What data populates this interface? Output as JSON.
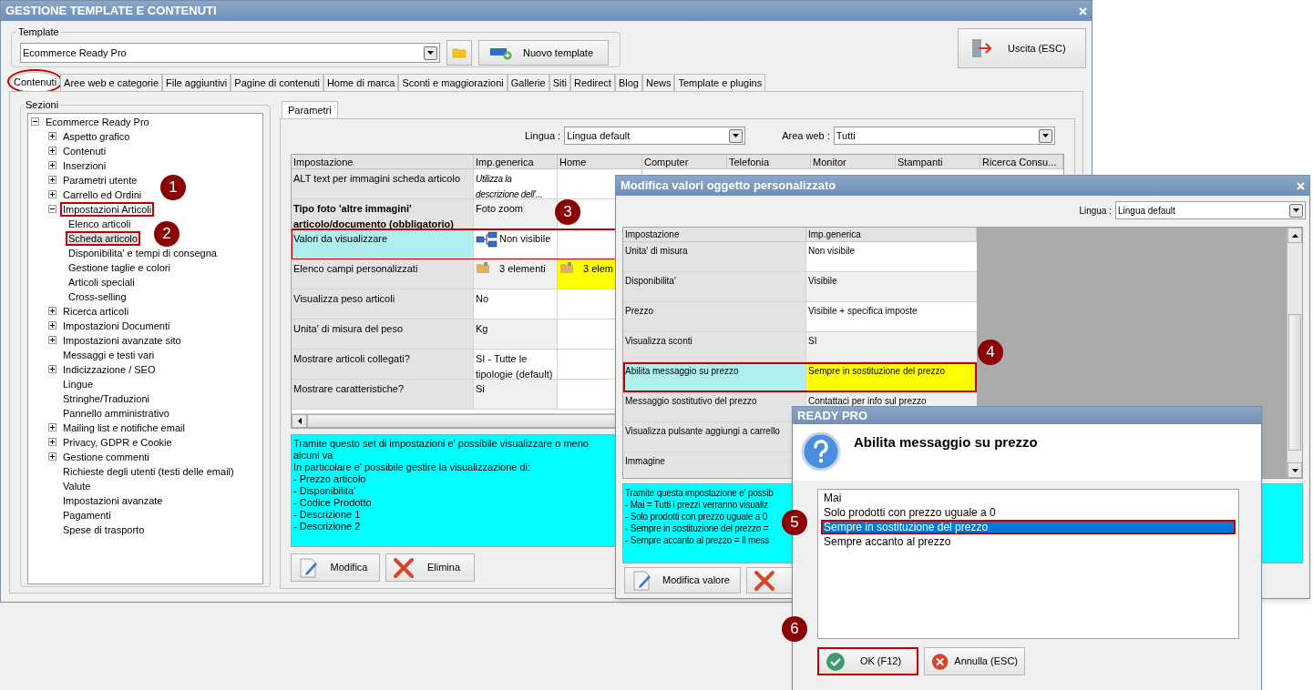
{
  "main_window": {
    "title": "GESTIONE TEMPLATE E CONTENUTI",
    "template": {
      "label": "Template",
      "value": "Ecommerce Ready Pro",
      "new_button": "Nuovo template"
    },
    "exit_button": "Uscita (ESC)",
    "tabs": [
      {
        "label": "Contenuti",
        "selected": true,
        "annotated": true
      },
      {
        "label": "Aree web e categorie",
        "selected": false,
        "annotated": false
      },
      {
        "label": "File aggiuntivi",
        "selected": false,
        "annotated": false
      },
      {
        "label": "Pagine di contenuti",
        "selected": false,
        "annotated": false
      },
      {
        "label": "Home di marca",
        "selected": false,
        "annotated": false
      },
      {
        "label": "Sconti e maggiorazioni",
        "selected": false,
        "annotated": false
      },
      {
        "label": "Gallerie",
        "selected": false,
        "annotated": false
      },
      {
        "label": "Siti",
        "selected": false,
        "annotated": false
      },
      {
        "label": "Redirect",
        "selected": false,
        "annotated": false
      },
      {
        "label": "Blog",
        "selected": false,
        "annotated": false
      },
      {
        "label": "News",
        "selected": false,
        "annotated": false
      },
      {
        "label": "Template e plugins",
        "selected": false,
        "annotated": false
      }
    ],
    "sections": {
      "label": "Sezioni",
      "tree": {
        "label": "Ecommerce Ready Pro",
        "kind": "node",
        "expanded": true,
        "selected": false,
        "annotated": false,
        "children": [
          {
            "label": "Aspetto grafico",
            "kind": "node",
            "expanded": false,
            "selected": false,
            "annotated": false
          },
          {
            "label": "Contenuti",
            "kind": "node",
            "expanded": false,
            "selected": false,
            "annotated": false
          },
          {
            "label": "Inserzioni",
            "kind": "node",
            "expanded": false,
            "selected": false,
            "annotated": false
          },
          {
            "label": "Parametri utente",
            "kind": "node",
            "expanded": false,
            "selected": false,
            "annotated": false
          },
          {
            "label": "Carrello ed Ordini",
            "kind": "node",
            "expanded": false,
            "selected": false,
            "annotated": false
          },
          {
            "label": "Impostazioni Articoli",
            "kind": "node",
            "expanded": true,
            "selected": false,
            "annotated": true,
            "children": [
              {
                "label": "Elenco articoli",
                "kind": "leaf",
                "selected": false,
                "annotated": false
              },
              {
                "label": "Scheda articolo",
                "kind": "leaf",
                "selected": true,
                "annotated": true
              },
              {
                "label": "Disponibilita' e tempi di consegna",
                "kind": "leaf",
                "selected": false,
                "annotated": false
              },
              {
                "label": "Gestione taglie e colori",
                "kind": "leaf",
                "selected": false,
                "annotated": false
              },
              {
                "label": "Articoli speciali",
                "kind": "leaf",
                "selected": false,
                "annotated": false
              },
              {
                "label": "Cross-selling",
                "kind": "leaf",
                "selected": false,
                "annotated": false
              }
            ]
          },
          {
            "label": "Ricerca articoli",
            "kind": "node",
            "expanded": false,
            "selected": false,
            "annotated": false
          },
          {
            "label": "Impostazioni Documenti",
            "kind": "node",
            "expanded": false,
            "selected": false,
            "annotated": false
          },
          {
            "label": "Impostazioni avanzate sito",
            "kind": "node",
            "expanded": false,
            "selected": false,
            "annotated": false
          },
          {
            "label": "Messaggi e testi vari",
            "kind": "leaf",
            "selected": false,
            "annotated": false
          },
          {
            "label": "Indicizzazione / SEO",
            "kind": "node",
            "expanded": false,
            "selected": false,
            "annotated": false
          },
          {
            "label": "Lingue",
            "kind": "leaf",
            "selected": false,
            "annotated": false
          },
          {
            "label": "Stringhe/Traduzioni",
            "kind": "leaf",
            "selected": false,
            "annotated": false
          },
          {
            "label": "Pannello amministrativo",
            "kind": "leaf",
            "selected": false,
            "annotated": false
          },
          {
            "label": "Mailing list e notifiche email",
            "kind": "node",
            "expanded": false,
            "selected": false,
            "annotated": false
          },
          {
            "label": "Privacy, GDPR e Cookie",
            "kind": "node",
            "expanded": false,
            "selected": false,
            "annotated": false
          },
          {
            "label": "Gestione commenti",
            "kind": "node",
            "expanded": false,
            "selected": false,
            "annotated": false
          },
          {
            "label": "Richieste degli utenti (testi delle email)",
            "kind": "leaf",
            "selected": false,
            "annotated": false
          },
          {
            "label": "Valute",
            "kind": "leaf",
            "selected": false,
            "annotated": false
          },
          {
            "label": "Impostazioni avanzate",
            "kind": "leaf",
            "selected": false,
            "annotated": false
          },
          {
            "label": "Pagamenti",
            "kind": "leaf",
            "selected": false,
            "annotated": false
          },
          {
            "label": "Spese di trasporto",
            "kind": "leaf",
            "selected": false,
            "annotated": false
          }
        ]
      }
    },
    "subtab": {
      "label": "Parametri",
      "selected": true
    },
    "filters": [
      {
        "label": "Lingua :",
        "value": "Lingua default"
      },
      {
        "label": "Area web :",
        "value": "Tutti"
      }
    ],
    "grid": {
      "columns": [
        "Impostazione",
        "Imp.generica",
        "Home",
        "Computer",
        "Telefonia",
        "Monitor",
        "Stampanti",
        "Ricerca Consu..."
      ],
      "rows": [
        {
          "setting": "ALT text per immagini scheda articolo",
          "strong": false,
          "selected": false,
          "annotated": false,
          "value": {
            "text": "Utilizza la descrizione dell'...",
            "kind": "italic",
            "customized": false
          }
        },
        {
          "setting": "Tipo foto 'altre immagini' articolo/documento (obbligatorio)",
          "strong": true,
          "selected": false,
          "annotated": false,
          "value": {
            "text": "Foto zoom",
            "kind": "text",
            "customized": false
          }
        },
        {
          "setting": "Valori da visualizzare",
          "strong": false,
          "selected": true,
          "annotated": true,
          "value": {
            "text": "Non visibile",
            "kind": "structure",
            "customized": false
          }
        },
        {
          "setting": "Elenco campi personalizzati",
          "strong": false,
          "selected": false,
          "annotated": false,
          "value": {
            "text": "3 elementi",
            "kind": "folder",
            "customized": false
          },
          "home": {
            "text": "3 elem",
            "kind": "folder",
            "customized": true
          }
        },
        {
          "setting": "Visualizza peso articoli",
          "strong": false,
          "selected": false,
          "annotated": false,
          "value": {
            "text": "No",
            "kind": "text",
            "customized": false
          }
        },
        {
          "setting": "Unita' di misura del peso",
          "strong": false,
          "selected": false,
          "annotated": false,
          "value": {
            "text": "Kg",
            "kind": "text",
            "customized": false
          }
        },
        {
          "setting": "Mostrare articoli collegati?",
          "strong": false,
          "selected": false,
          "annotated": false,
          "value": {
            "text": "SI - Tutte le tipologie (default)",
            "kind": "text",
            "customized": false
          }
        },
        {
          "setting": "Mostrare caratteristiche?",
          "strong": false,
          "selected": false,
          "annotated": false,
          "value": {
            "text": "Si",
            "kind": "text",
            "customized": false
          }
        }
      ]
    },
    "description": [
      "Tramite questo set di impostazioni e' possibile visualizzare o meno alcuni va",
      "In particolare e' possibile gestire la visualizzazione di:",
      "- Prezzo articolo",
      "- Disponibilita'",
      "- Codice Prodotto",
      "- Descrizione 1",
      "- Descrizione 2"
    ],
    "buttons": [
      {
        "label": "Modifica",
        "kind": "edit"
      },
      {
        "label": "Elimina",
        "kind": "delete"
      }
    ]
  },
  "edit_dialog": {
    "title": "Modifica valori oggetto personalizzato",
    "filter": {
      "label": "Lingua :",
      "value": "Lingua default"
    },
    "columns": [
      "Impostazione",
      "Imp.generica"
    ],
    "rows": [
      {
        "setting": "Unita' di misura",
        "selected": false,
        "annotated": false,
        "value": {
          "text": "Non visibile",
          "customized": false
        }
      },
      {
        "setting": "Disponibilita'",
        "selected": false,
        "annotated": false,
        "value": {
          "text": "Visibile",
          "customized": false
        }
      },
      {
        "setting": "Prezzo",
        "selected": false,
        "annotated": false,
        "value": {
          "text": "Visibile + specifica imposte",
          "customized": false
        }
      },
      {
        "setting": "Visualizza sconti",
        "selected": false,
        "annotated": false,
        "value": {
          "text": "SI",
          "customized": false
        }
      },
      {
        "setting": "Abilita messaggio su prezzo",
        "selected": true,
        "annotated": true,
        "value": {
          "text": "Sempre in sostituzione del prezzo",
          "customized": true
        }
      },
      {
        "setting": "Messaggio sostitutivo del prezzo",
        "selected": false,
        "annotated": false,
        "value": {
          "text": "Contattaci per info sul prezzo",
          "customized": false
        }
      },
      {
        "setting": "Visualizza pulsante aggiungi a carrello",
        "selected": false,
        "annotated": false
      },
      {
        "setting": "Immagine",
        "selected": false,
        "annotated": false
      }
    ],
    "description": [
      "Tramite questa impostazione e' possib",
      "- Mai = Tutti i prezzi verranno visualiz",
      "- Solo prodotti con prezzo uguale a 0",
      "- Sempre in sostituzione del prezzo =",
      "- Sempre accanto al prezzo =  Il mess"
    ],
    "buttons": [
      {
        "label": "Modifica valore",
        "kind": "edit"
      },
      {
        "kind": "delete"
      }
    ]
  },
  "choice_dialog": {
    "title": "READY PRO",
    "question": "Abilita messaggio su prezzo",
    "options": [
      {
        "label": "Mai",
        "selected": false,
        "annotated": false
      },
      {
        "label": "Solo prodotti con prezzo uguale a 0",
        "selected": false,
        "annotated": false
      },
      {
        "label": "Sempre in sostituzione del prezzo",
        "selected": true,
        "annotated": true
      },
      {
        "label": "Sempre accanto al prezzo",
        "selected": false,
        "annotated": false
      }
    ],
    "buttons": [
      {
        "label": "OK (F12)",
        "kind": "ok",
        "annotated": true
      },
      {
        "label": "Annulla (ESC)",
        "kind": "cancel",
        "annotated": false
      }
    ]
  },
  "annotations": [
    "1",
    "2",
    "3",
    "4",
    "5",
    "6"
  ]
}
